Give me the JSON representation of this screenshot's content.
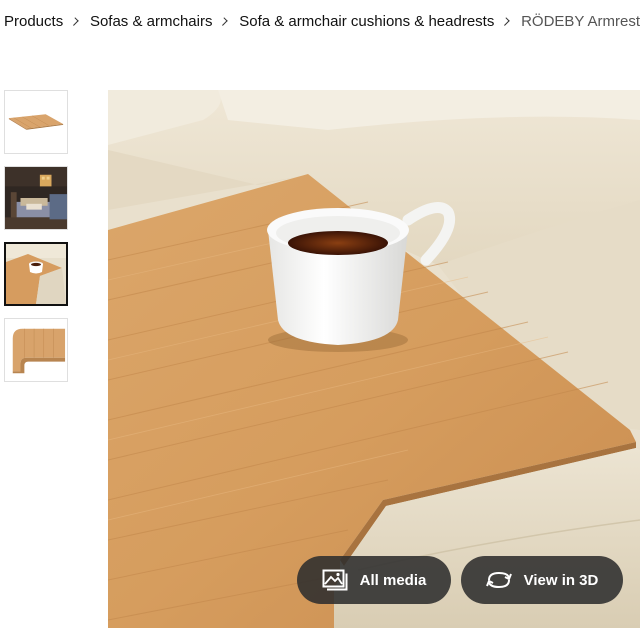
{
  "breadcrumb": {
    "items": [
      "Products",
      "Sofas & armchairs",
      "Sofa & armchair cushions & headrests"
    ],
    "current": "RÖDEBY Armrest"
  },
  "gallery": {
    "thumbnails": [
      {
        "icon": "bamboo-tray-flat-thumbnail"
      },
      {
        "icon": "living-room-scene-thumbnail"
      },
      {
        "icon": "armrest-with-cup-thumbnail"
      },
      {
        "icon": "rolled-tray-thumbnail"
      }
    ],
    "active_index": 2
  },
  "actions": {
    "all_media_label": "All media",
    "all_media_icon": "image-gallery-icon",
    "view_3d_label": "View in 3D",
    "view_3d_icon": "rotate-3d-icon"
  },
  "colors": {
    "pill_background": "#2d2d2d",
    "wood": "#d49c63",
    "sofa_leather": "#ebe2cf"
  }
}
